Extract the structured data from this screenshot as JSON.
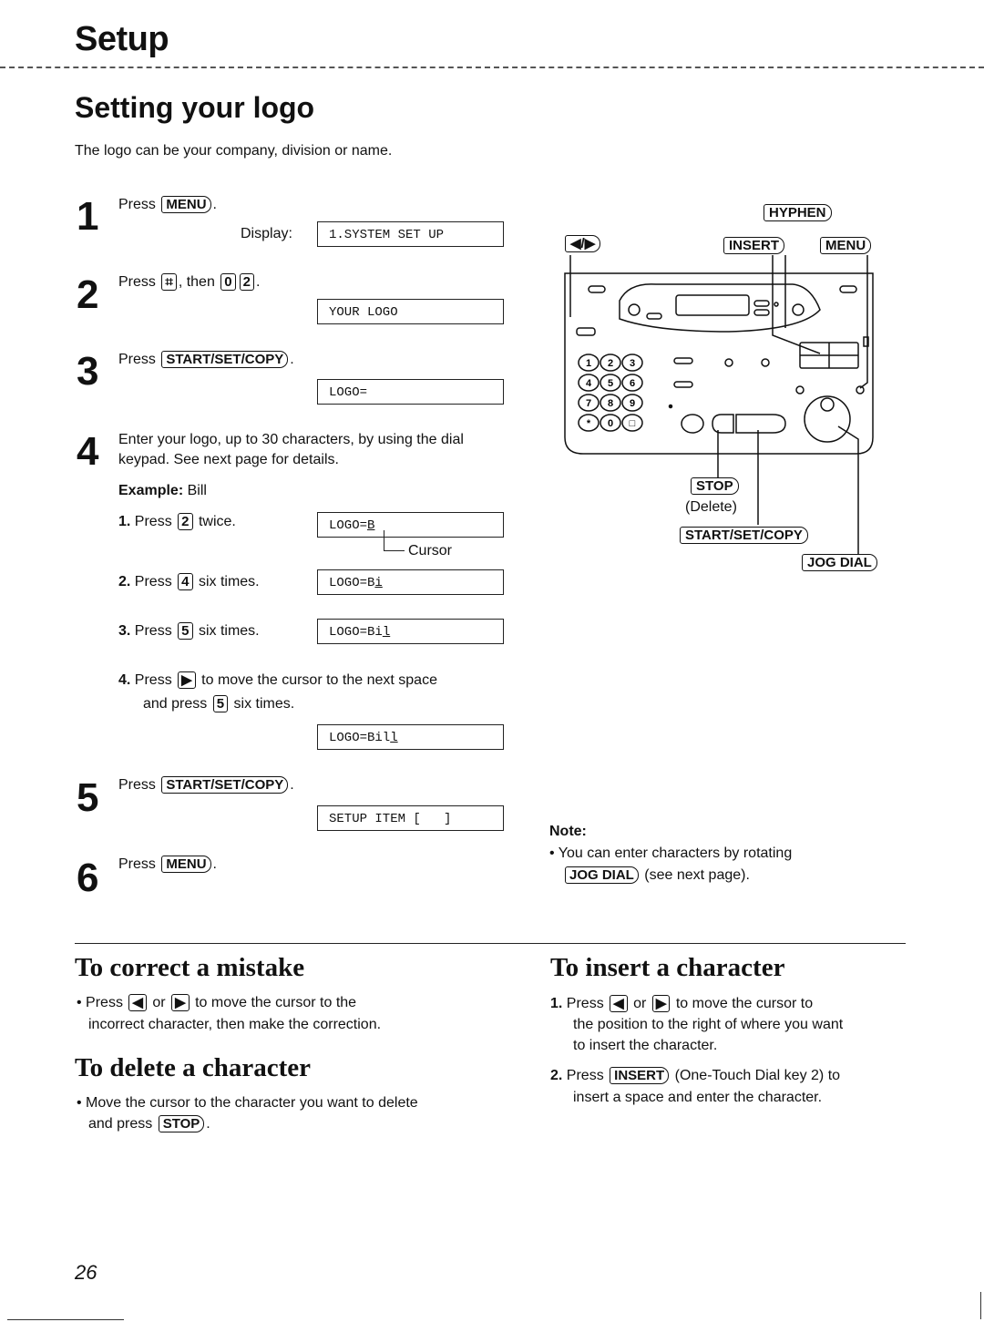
{
  "header": {
    "section": "Setup"
  },
  "title": "Setting your logo",
  "intro": "The logo can be your company, division or name.",
  "steps": [
    {
      "num": "1",
      "press": "Press",
      "key": "MENU",
      "display_label": "Display:",
      "display": "1.SYSTEM SET UP"
    },
    {
      "num": "2",
      "press": "Press",
      "key1": "⌗",
      "then": ", then",
      "key2": "0",
      "key3": "2",
      "display": "YOUR LOGO"
    },
    {
      "num": "3",
      "press": "Press",
      "key": "START/SET/COPY",
      "display": "LOGO="
    },
    {
      "num": "4",
      "text": "Enter your logo, up to 30 characters, by using the dial keypad. See next page for details.",
      "example_label": "Example:",
      "example_value": "Bill",
      "substeps": [
        {
          "n": "1.",
          "press": "Press",
          "key": "2",
          "rest": "twice.",
          "display_prefix": "LOGO=",
          "display_cursor": "B",
          "cursor_label": "Cursor"
        },
        {
          "n": "2.",
          "press": "Press",
          "key": "4",
          "rest": "six times.",
          "display_prefix": "LOGO=B",
          "display_cursor": "i"
        },
        {
          "n": "3.",
          "press": "Press",
          "key": "5",
          "rest": "six times.",
          "display_prefix": "LOGO=Bi",
          "display_cursor": "l"
        },
        {
          "n": "4.",
          "press": "Press",
          "key": "▶",
          "rest": "to move the cursor to the next space",
          "line2_pre": "and press",
          "key2": "5",
          "line2_post": "six times.",
          "display_prefix": "LOGO=Bil",
          "display_cursor": "l"
        }
      ]
    },
    {
      "num": "5",
      "press": "Press",
      "key": "START/SET/COPY",
      "display": "SETUP ITEM [   ]"
    },
    {
      "num": "6",
      "press": "Press",
      "key": "MENU"
    }
  ],
  "diagram": {
    "labels": {
      "arrows": "◀/▶",
      "hyphen": "HYPHEN",
      "insert": "INSERT",
      "menu": "MENU",
      "stop": "STOP",
      "delete": "(Delete)",
      "start": "START/SET/COPY",
      "jog": "JOG DIAL"
    },
    "keypad": [
      "1",
      "2",
      "3",
      "4",
      "5",
      "6",
      "7",
      "8",
      "9",
      "*",
      "0",
      "□"
    ]
  },
  "note": {
    "title": "Note:",
    "line1": "You can enter characters by rotating",
    "key": "JOG DIAL",
    "line2": "(see next page)."
  },
  "correct": {
    "title": "To correct a mistake",
    "press": "Press",
    "key1": "◀",
    "or": "or",
    "key2": "▶",
    "rest": "to move the cursor to the",
    "line2": "incorrect character, then make the correction."
  },
  "delete": {
    "title": "To delete a character",
    "line1": "Move the cursor to the character you want to delete",
    "line2_pre": "and press",
    "key": "STOP"
  },
  "insert": {
    "title": "To insert a character",
    "s1_n": "1.",
    "s1_press": "Press",
    "s1_key1": "◀",
    "s1_or": "or",
    "s1_key2": "▶",
    "s1_rest": "to move the cursor to",
    "s1_line2": "the position to the right of where you want",
    "s1_line3": "to insert the character.",
    "s2_n": "2.",
    "s2_press": "Press",
    "s2_key": "INSERT",
    "s2_rest": "(One-Touch Dial key 2) to",
    "s2_line2": "insert a space and enter the character."
  },
  "page_number": "26"
}
